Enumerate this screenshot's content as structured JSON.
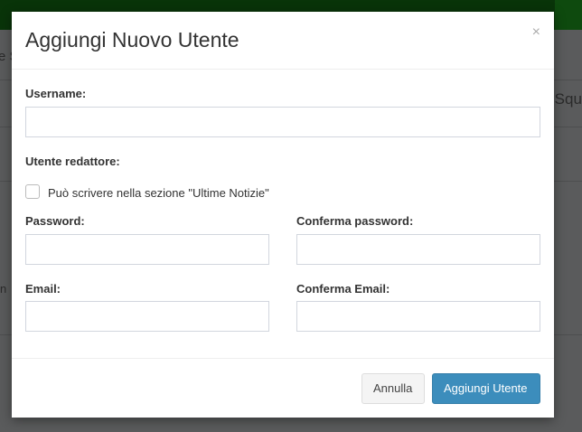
{
  "background": {
    "fragment_left": "e S",
    "fragment_right": "-Squ",
    "fragment_left2": "n"
  },
  "modal": {
    "title": "Aggiungi Nuovo Utente",
    "close": "×",
    "username_label": "Username:",
    "editor_label": "Utente redattore:",
    "editor_checkbox": "Può scrivere nella sezione \"Ultime Notizie\"",
    "password_label": "Password:",
    "confirm_password_label": "Conferma password:",
    "email_label": "Email:",
    "confirm_email_label": "Conferma Email:",
    "cancel": "Annulla",
    "submit": "Aggiungi Utente"
  }
}
